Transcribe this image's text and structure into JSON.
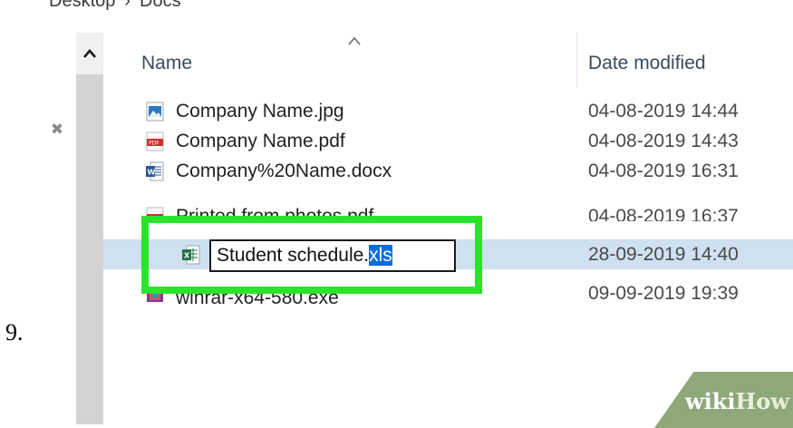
{
  "step_number": "9.",
  "breadcrumb": {
    "parts": [
      "Desktop",
      "Docs"
    ],
    "separator": "›"
  },
  "columns": {
    "name": "Name",
    "date": "Date modified"
  },
  "files": [
    {
      "name": "Company Name.jpg",
      "date": "04-08-2019 14:44",
      "icon": "jpg-image-icon"
    },
    {
      "name": "Company Name.pdf",
      "date": "04-08-2019 14:43",
      "icon": "pdf-icon"
    },
    {
      "name": "Company%20Name.docx",
      "date": "04-08-2019 16:31",
      "icon": "word-doc-icon"
    },
    {
      "name": "Printed from photos.pdf",
      "date": "04-08-2019 16:37",
      "icon": "pdf-icon"
    },
    {
      "name": "",
      "date": "28-09-2019 14:40",
      "icon": "excel-icon",
      "selected": true
    },
    {
      "name": "winrar-x64-580.exe",
      "date": "09-09-2019 19:39",
      "icon": "winrar-exe-icon"
    }
  ],
  "rename": {
    "base": "Student schedule.",
    "ext_selected": "xls"
  },
  "watermark": {
    "part1": "wiki",
    "part2": "How"
  },
  "colors": {
    "highlight": "#2ce32c",
    "selected_row": "#cfe0f1",
    "text_selection": "#0a6cd6"
  }
}
